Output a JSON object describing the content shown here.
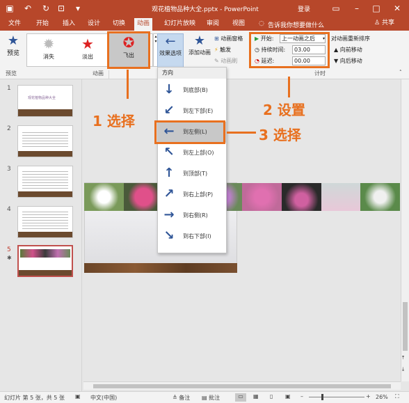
{
  "titlebar": {
    "filename": "观花植物品种大全.pptx  -  PowerPoint",
    "signin": "登录"
  },
  "tabs": [
    "文件",
    "开始",
    "插入",
    "设计",
    "切换",
    "动画",
    "幻灯片放映",
    "审阅",
    "视图"
  ],
  "tell_me": "告诉我你想要做什么",
  "share": "共享",
  "ribbon": {
    "preview": "预览",
    "group_preview": "预览",
    "group_anim": "动画",
    "group_timing": "计时",
    "animations": [
      {
        "label": "消失"
      },
      {
        "label": "淡出"
      },
      {
        "label": "飞出"
      }
    ],
    "effect_options": "效果选项",
    "add_anim": "添加动画",
    "adv": [
      "动画窗格",
      "触发",
      "动画刷"
    ],
    "start_label": "开始:",
    "start_value": "上一动画之后",
    "duration_label": "持续时间:",
    "duration_value": "03.00",
    "delay_label": "延迟:",
    "delay_value": "00.00",
    "reorder": "对动画重新排序",
    "move_earlier": "向前移动",
    "move_later": "向后移动"
  },
  "menu": {
    "header": "方向",
    "items": [
      {
        "label": "到底部(B)",
        "arrow": "↓"
      },
      {
        "label": "到左下部(E)",
        "arrow": "↙"
      },
      {
        "label": "到左侧(L)",
        "arrow": "←"
      },
      {
        "label": "到左上部(O)",
        "arrow": "↖"
      },
      {
        "label": "到顶部(T)",
        "arrow": "↑"
      },
      {
        "label": "到右上部(P)",
        "arrow": "↗"
      },
      {
        "label": "到右侧(R)",
        "arrow": "→"
      },
      {
        "label": "到右下部(I)",
        "arrow": "↘"
      }
    ]
  },
  "callouts": {
    "c1": "1 选择",
    "c2": "2 设置",
    "c3": "3 选择"
  },
  "slides": [
    "1",
    "2",
    "3",
    "4",
    "5"
  ],
  "thumb1_title": "观花植物品种大全",
  "status": {
    "slide": "幻灯片 第 5 张，共 5 张",
    "lang": "中文(中国)",
    "notes": "备注",
    "comments": "批注",
    "zoom": "26%"
  }
}
